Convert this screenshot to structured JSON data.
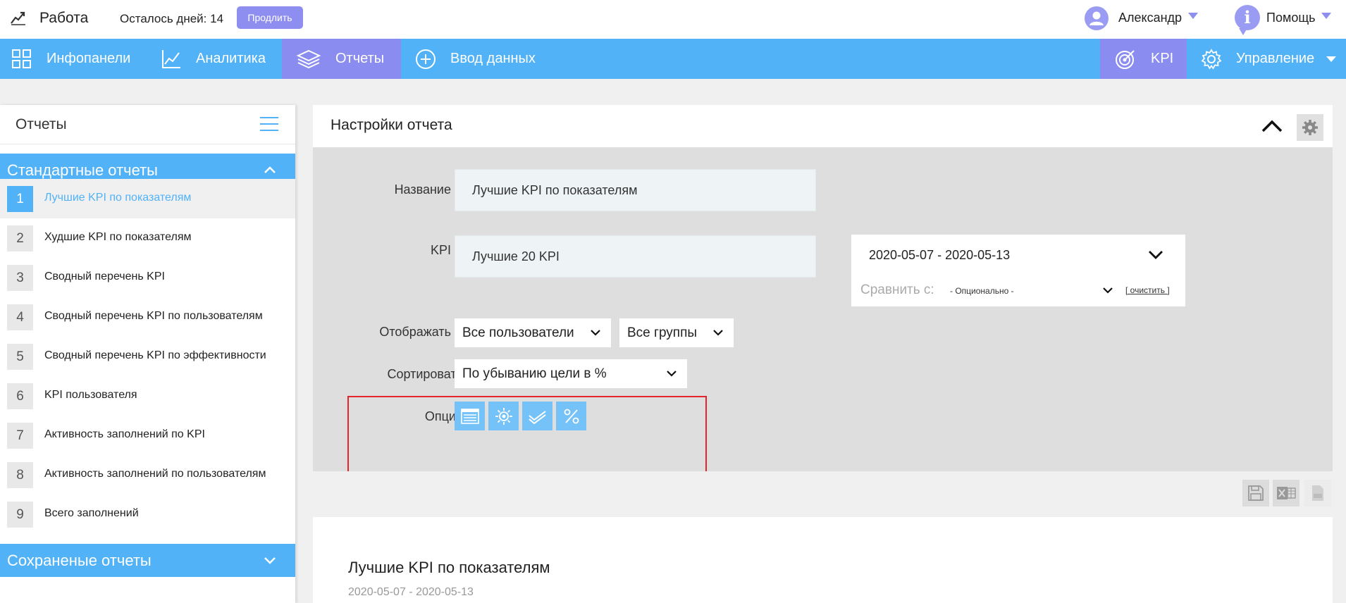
{
  "topbar": {
    "brand": "Работа",
    "days_left": "Осталось дней: 14",
    "extend_label": "Продлить",
    "user_name": "Александр",
    "help_label": "Помощь"
  },
  "nav": {
    "infopanels": "Инфопанели",
    "analytics": "Аналитика",
    "reports": "Отчеты",
    "data_entry": "Ввод данных",
    "kpi": "KPI",
    "management": "Управление"
  },
  "sidebar": {
    "title": "Отчеты",
    "standard_section": "Стандартные отчеты",
    "saved_section": "Сохраненые отчеты",
    "reports": [
      {
        "num": "1",
        "label": "Лучшие KPI по показателям"
      },
      {
        "num": "2",
        "label": "Худшие KPI по показателям"
      },
      {
        "num": "3",
        "label": "Сводный перечень KPI"
      },
      {
        "num": "4",
        "label": "Сводный перечень KPI по пользователям"
      },
      {
        "num": "5",
        "label": "Сводный перечень KPI по эффективности"
      },
      {
        "num": "6",
        "label": "KPI пользователя"
      },
      {
        "num": "7",
        "label": "Активность заполнений по KPI"
      },
      {
        "num": "8",
        "label": "Активность заполнений по пользователям"
      },
      {
        "num": "9",
        "label": "Всего заполнений"
      }
    ]
  },
  "settings": {
    "title": "Настройки отчета",
    "name_label": "Название",
    "name_value": "Лучшие KPI по показателям",
    "kpi_label": "KPI",
    "kpi_value": "Лучшие 20 KPI",
    "date_range": "2020-05-07 - 2020-05-13",
    "compare_label": "Сравнить с:",
    "compare_value": "- Опционально -",
    "clear_label": "[ очистить ]",
    "display_label": "Отображать",
    "users_value": "Все пользователи",
    "groups_value": "Все группы",
    "sort_label": "Сортировать",
    "sort_value": "По убыванию цели в %",
    "options_label": "Опции"
  },
  "report": {
    "title": "Лучшие KPI по показателям",
    "dates": "2020-05-07 - 2020-05-13"
  },
  "colors": {
    "primary": "#51b2f7",
    "accent": "#8b8cf0",
    "highlight": "#e3242b"
  }
}
